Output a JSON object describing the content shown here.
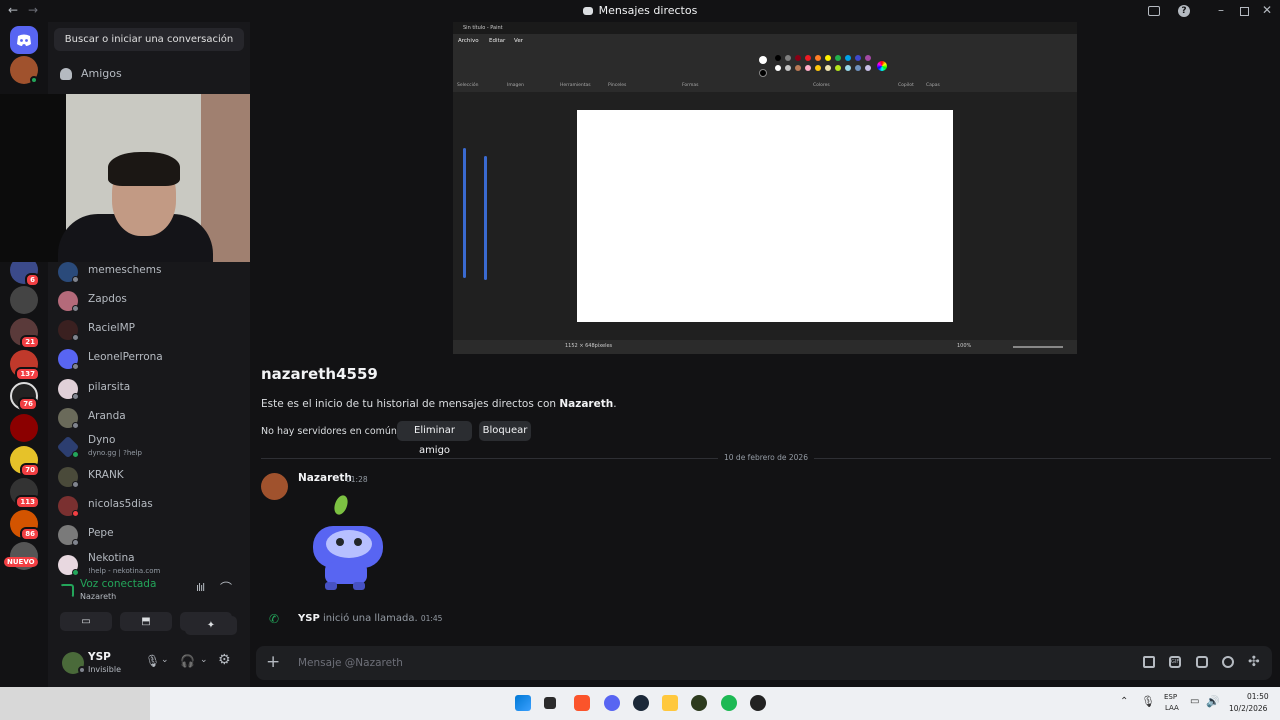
{
  "window": {
    "title": "Mensajes directos",
    "back": "←",
    "forward": "→"
  },
  "search": {
    "label": "Buscar o iniciar una conversación"
  },
  "friends": {
    "label": "Amigos"
  },
  "badges": [
    "6",
    "21",
    "137",
    "76",
    "70",
    "113",
    "86"
  ],
  "nuevo": "NUEVO",
  "dms": [
    {
      "name": "memeschems",
      "sub": ""
    },
    {
      "name": "Zapdos",
      "sub": ""
    },
    {
      "name": "RacielMP",
      "sub": ""
    },
    {
      "name": "LeonelPerrona",
      "sub": ""
    },
    {
      "name": "pilarsita",
      "sub": ""
    },
    {
      "name": "Aranda",
      "sub": ""
    },
    {
      "name": "Dyno",
      "sub": "dyno.gg | ?help"
    },
    {
      "name": "KRANK",
      "sub": ""
    },
    {
      "name": "nicolas5dias",
      "sub": ""
    },
    {
      "name": "Pepe",
      "sub": ""
    },
    {
      "name": "Nekotina",
      "sub": "!help - nekotina.com"
    }
  ],
  "voice": {
    "status": "Voz conectada",
    "channel": "Nazareth"
  },
  "user": {
    "name": "YSP",
    "status": "Invisible"
  },
  "paint": {
    "title": "Sin título - Paint",
    "menu": [
      "Archivo",
      "Editar",
      "Ver"
    ],
    "groups": [
      "Selección",
      "Imagen",
      "Herramientas",
      "Pinceles",
      "Formas",
      "Colores",
      "Copilot",
      "Capas"
    ],
    "size": "1152 × 648píxeles",
    "zoom": "100%"
  },
  "profile": {
    "username": "nazareth4559",
    "intro_prefix": "Este es el inicio de tu historial de mensajes directos con ",
    "intro_name": "Nazareth",
    "intro_suffix": ".",
    "no_servers": "No hay servidores en común",
    "remove_friend": "Eliminar amigo",
    "block": "Bloquear"
  },
  "date_divider": "10 de febrero de 2026",
  "message": {
    "author": "Nazareth",
    "time": "01:28"
  },
  "call": {
    "user": "YSP",
    "text": "inició una llamada.",
    "time": "01:45"
  },
  "composer": {
    "placeholder": "Mensaje @Nazareth"
  },
  "tray": {
    "lang1": "ESP",
    "lang2": "LAA",
    "time": "01:50",
    "date": "10/2/2026"
  },
  "colors": {
    "accent": "#5865f2",
    "online": "#23a55a",
    "danger": "#f23f43",
    "call": "#23a55a"
  }
}
